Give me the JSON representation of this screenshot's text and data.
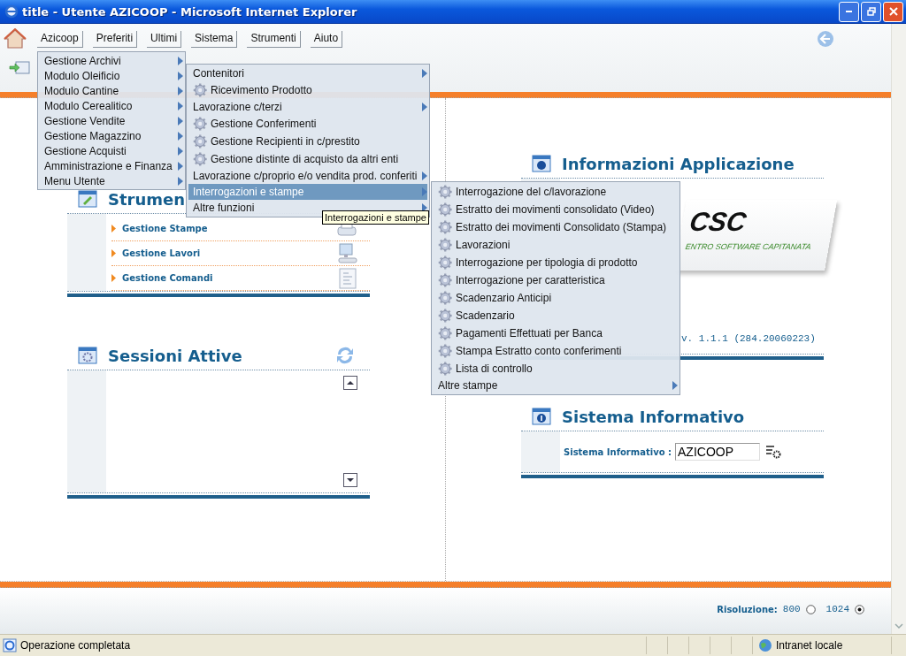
{
  "window": {
    "title": "title - Utente AZICOOP - Microsoft Internet Explorer"
  },
  "menu_bar": [
    {
      "label": "Azicoop"
    },
    {
      "label": "Preferiti"
    },
    {
      "label": "Ultimi"
    },
    {
      "label": "Sistema"
    },
    {
      "label": "Strumenti"
    },
    {
      "label": "Aiuto"
    }
  ],
  "menus": [
    {
      "items": [
        {
          "label": "Gestione Archivi",
          "kind": "submenu",
          "selected": false
        },
        {
          "label": "Modulo Oleificio",
          "kind": "submenu",
          "selected": false
        },
        {
          "label": "Modulo Cantine",
          "kind": "submenu",
          "selected": false
        },
        {
          "label": "Modulo Cerealitico",
          "kind": "submenu",
          "selected": false
        },
        {
          "label": "Gestione Vendite",
          "kind": "submenu",
          "selected": false
        },
        {
          "label": "Gestione Magazzino",
          "kind": "submenu",
          "selected": false
        },
        {
          "label": "Gestione Acquisti",
          "kind": "submenu",
          "selected": false
        },
        {
          "label": "Amministrazione e Finanza",
          "kind": "submenu",
          "selected": false
        },
        {
          "label": "Menu Utente",
          "kind": "submenu",
          "selected": false
        }
      ]
    },
    {
      "items": [
        {
          "label": "Contenitori",
          "kind": "submenu",
          "selected": false
        },
        {
          "label": "Ricevimento Prodotto",
          "kind": "action",
          "selected": false
        },
        {
          "label": "Lavorazione c/terzi",
          "kind": "submenu",
          "selected": false
        },
        {
          "label": "Gestione Conferimenti",
          "kind": "action",
          "selected": false
        },
        {
          "label": "Gestione Recipienti in c/prestito",
          "kind": "action",
          "selected": false
        },
        {
          "label": "Gestione distinte di acquisto da altri enti",
          "kind": "action",
          "selected": false
        },
        {
          "label": "Lavorazione c/proprio e/o vendita prod. conferiti",
          "kind": "submenu",
          "selected": false
        },
        {
          "label": "Interrogazioni e stampe",
          "kind": "submenu",
          "selected": true
        },
        {
          "label": "Altre funzioni",
          "kind": "submenu",
          "selected": false
        }
      ]
    },
    {
      "items": [
        {
          "label": "Interrogazione del c/lavorazione",
          "kind": "action",
          "selected": false
        },
        {
          "label": "Estratto dei movimenti consolidato (Video)",
          "kind": "action",
          "selected": false
        },
        {
          "label": "Estratto dei movimenti Consolidato (Stampa)",
          "kind": "action",
          "selected": false
        },
        {
          "label": "Lavorazioni",
          "kind": "action",
          "selected": false
        },
        {
          "label": "Interrogazione per tipologia di prodotto",
          "kind": "action",
          "selected": false
        },
        {
          "label": "Interrogazione per caratteristica",
          "kind": "action",
          "selected": false
        },
        {
          "label": "Scadenzario Anticipi",
          "kind": "action",
          "selected": false
        },
        {
          "label": "Scadenzario",
          "kind": "action",
          "selected": false
        },
        {
          "label": "Pagamenti Effettuati per Banca",
          "kind": "action",
          "selected": false
        },
        {
          "label": "Stampa Estratto conto conferimenti",
          "kind": "action",
          "selected": false
        },
        {
          "label": "Lista di controllo",
          "kind": "action",
          "selected": false
        },
        {
          "label": "Altre stampe",
          "kind": "submenu",
          "selected": false
        }
      ]
    }
  ],
  "tooltip": "Interrogazioni e stampe",
  "tools_panel": {
    "title": "Strumen",
    "items": [
      {
        "label": "Gestione Stampe"
      },
      {
        "label": "Gestione Lavori"
      },
      {
        "label": "Gestione Comandi"
      }
    ]
  },
  "sessions_panel": {
    "title": "Sessioni Attive"
  },
  "info_panel": {
    "title": "Informazioni Applicazione",
    "logo_name": "CSC",
    "logo_tagline": "ENTRO SOFTWARE CAPITANATA",
    "version": "v. 1.1.1 (284.20060223)"
  },
  "system_panel": {
    "title": "Sistema Informativo",
    "field_label": "Sistema Informativo :",
    "value": "AZICOOP"
  },
  "resolution": {
    "label": "Risoluzione:",
    "options": [
      {
        "label": "800",
        "selected": false
      },
      {
        "label": "1024",
        "selected": true
      }
    ]
  },
  "status_bar": {
    "message": "Operazione completata",
    "zone": "Intranet locale"
  }
}
